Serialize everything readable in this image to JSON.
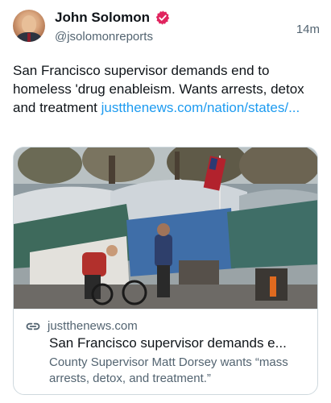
{
  "author": {
    "name": "John Solomon",
    "handle": "@jsolomonreports",
    "verified": true,
    "timestamp": "14m"
  },
  "tweet": {
    "text": "San Francisco supervisor demands end to homeless 'drug enableism. Wants arrests, detox and treatment ",
    "link_text": "justthenews.com/nation/states/..."
  },
  "card": {
    "domain": "justthenews.com",
    "title": "San Francisco supervisor demands e...",
    "description": "County Supervisor Matt Dorsey wants “mass arrests, detox, and treatment.”",
    "link_icon": "link-icon"
  },
  "colors": {
    "link": "#1d9bf0",
    "verified": "#e0245e",
    "secondary_text": "#536471",
    "border": "#cfd9de"
  }
}
